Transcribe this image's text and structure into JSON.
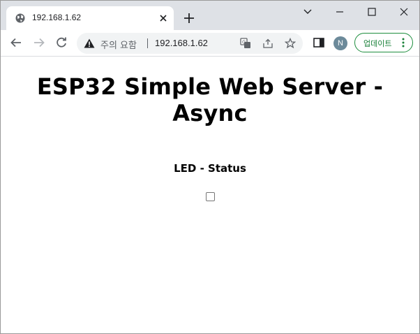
{
  "browser": {
    "tab": {
      "title": "192.168.1.62",
      "favicon": "globe-icon"
    },
    "omnibox": {
      "security_label": "주의 요함",
      "url": "192.168.1.62"
    },
    "profile": {
      "initial": "N"
    },
    "update_button": {
      "label": "업데이트"
    }
  },
  "page": {
    "title": "ESP32 Simple Web Server - Async",
    "led": {
      "label": "LED - Status",
      "checked": false
    }
  },
  "colors": {
    "tabstrip": "#dee1e6",
    "omnibox": "#f1f3f4",
    "update_accent": "#188038",
    "avatar": "#6c8a9a"
  }
}
